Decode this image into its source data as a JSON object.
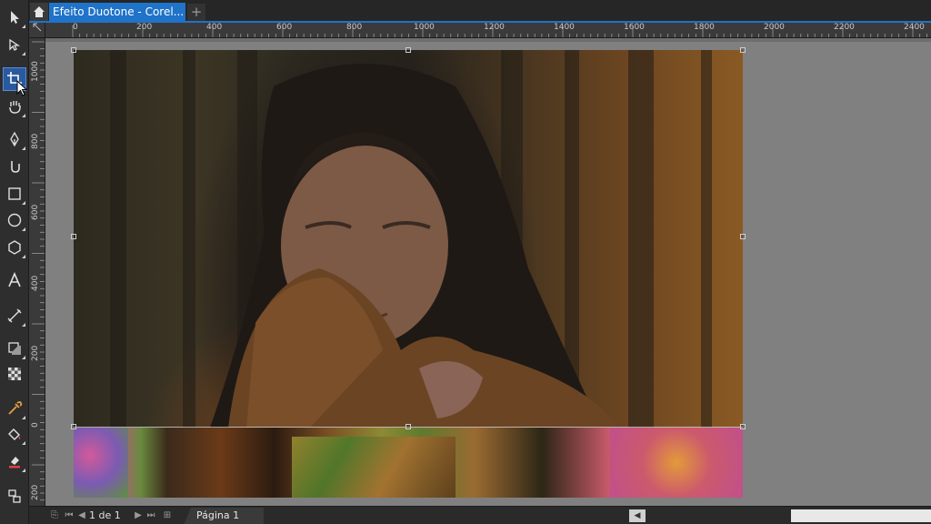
{
  "tabs": {
    "document_title": "Efeito Duotone - Corel...",
    "add_label": "+"
  },
  "ruler": {
    "horizontal_labels": [
      "0",
      "200",
      "400",
      "600",
      "800",
      "1000",
      "1200",
      "1400",
      "1600",
      "1800",
      "2000",
      "2200",
      "2400"
    ],
    "vertical_labels": [
      "1000",
      "800",
      "600",
      "400",
      "200",
      "0",
      "200"
    ]
  },
  "status": {
    "page_current": "1",
    "page_of": "de",
    "page_total": "1",
    "page_tab_label": "Página 1"
  },
  "toolbox": {
    "tools": [
      "pick-tool",
      "shape-tool",
      "crop-tool",
      "pan-tool",
      "freehand-tool",
      "artistic-media-tool",
      "rectangle-tool",
      "ellipse-tool",
      "polygon-tool",
      "text-tool",
      "dimension-tool",
      "drop-shadow-tool",
      "transparency-tool",
      "eyedropper-tool",
      "interactive-fill-tool",
      "smart-fill-tool",
      "connector-tool"
    ],
    "active_tool": "crop-tool"
  },
  "colors": {
    "accent": "#1f73c9",
    "workspace": "#808080",
    "toolbox_bg": "#2e2e2e"
  }
}
